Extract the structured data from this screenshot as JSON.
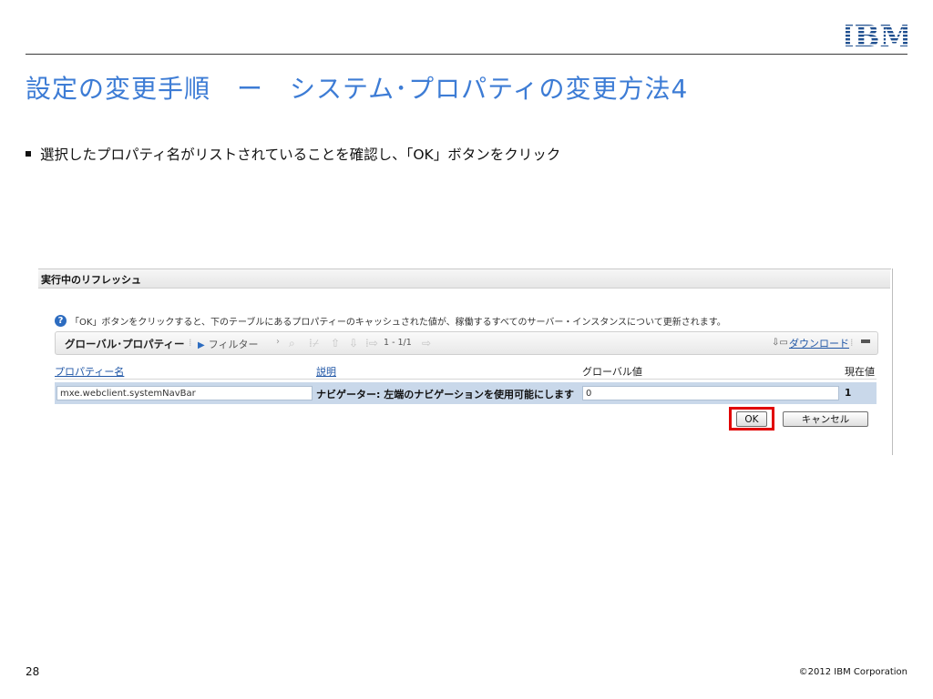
{
  "brand": {
    "logo_text": "IBM",
    "color": "#1f4f8f"
  },
  "slide": {
    "title": "設定の変更手順　ー　システム･プロパティの変更方法4",
    "title_color": "#3d7cd5",
    "bullet": "選択したプロパティ名がリストされていることを確認し、「OK」ボタンをクリック"
  },
  "panel": {
    "title": "実行中のリフレッシュ",
    "info_icon": "help-icon",
    "info_text": "「OK」ボタンをクリックすると、下のテーブルにあるプロパティーのキャッシュされた値が、稼働するすべてのサーバー・インスタンスについて更新されます。",
    "toolbar": {
      "title": "グローバル･プロパティー",
      "filter_label": "フィルター",
      "page_info": "1 - 1/1",
      "download_label": "ダウンロード"
    },
    "table": {
      "columns": [
        "プロパティー名",
        "説明",
        "グローバル値",
        "現在値"
      ],
      "rows": [
        {
          "name": "mxe.webclient.systemNavBar",
          "description": "ナビゲーター: 左端のナビゲーションを使用可能にします",
          "global_value": "0",
          "current_value": "1"
        }
      ]
    },
    "buttons": {
      "ok": "OK",
      "cancel": "キャンセル"
    },
    "highlight_color": "#e10000"
  },
  "footer": {
    "page_number": "28",
    "copyright": "©2012 IBM Corporation"
  }
}
